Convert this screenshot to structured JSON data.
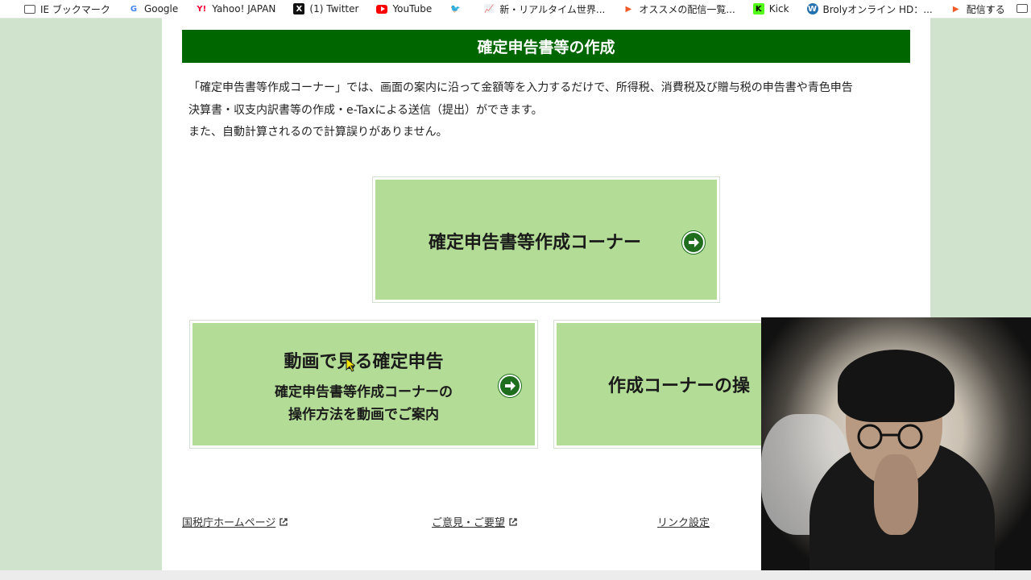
{
  "bookmarks": [
    {
      "label": "IE ブックマーク",
      "icon": "folder-icon"
    },
    {
      "label": "Google",
      "icon": "google-icon"
    },
    {
      "label": "Yahoo! JAPAN",
      "icon": "yahoo-icon"
    },
    {
      "label": "(1) Twitter",
      "icon": "x-icon"
    },
    {
      "label": "YouTube",
      "icon": "youtube-icon"
    },
    {
      "label": "",
      "icon": "twitter-bird-icon"
    },
    {
      "label": "新・リアルタイム世界...",
      "icon": "chart-icon"
    },
    {
      "label": "オススメの配信一覧...",
      "icon": "pocketplay-icon"
    },
    {
      "label": "Kick",
      "icon": "kick-icon"
    },
    {
      "label": "Brolyオンライン HD：...",
      "icon": "wordpress-icon"
    },
    {
      "label": "配信する",
      "icon": "pocketplay-icon"
    }
  ],
  "banner": {
    "title": "確定申告書等の作成"
  },
  "intro": {
    "line1": "「確定申告書等作成コーナー」では、画面の案内に沿って金額等を入力するだけで、所得税、消費税及び贈与税の申告書や青色申告",
    "line2": "決算書・収支内訳書等の作成・e-Taxによる送信（提出）ができます。",
    "line3": "また、自動計算されるので計算誤りがありません。"
  },
  "cards": {
    "main": {
      "label": "確定申告書等作成コーナー"
    },
    "video": {
      "title": "動画で見る確定申告",
      "sub1": "確定申告書等作成コーナーの",
      "sub2": "操作方法を動画でご案内"
    },
    "ops": {
      "label": "作成コーナーの操"
    }
  },
  "footer": {
    "link1": "国税庁ホームページ",
    "link2": "ご意見・ご要望",
    "link3": "リンク設定"
  },
  "colors": {
    "banner": "#006600",
    "card": "#b3dc96",
    "page_bg": "#cfe3cd",
    "arrow": "#1e6e1e"
  }
}
